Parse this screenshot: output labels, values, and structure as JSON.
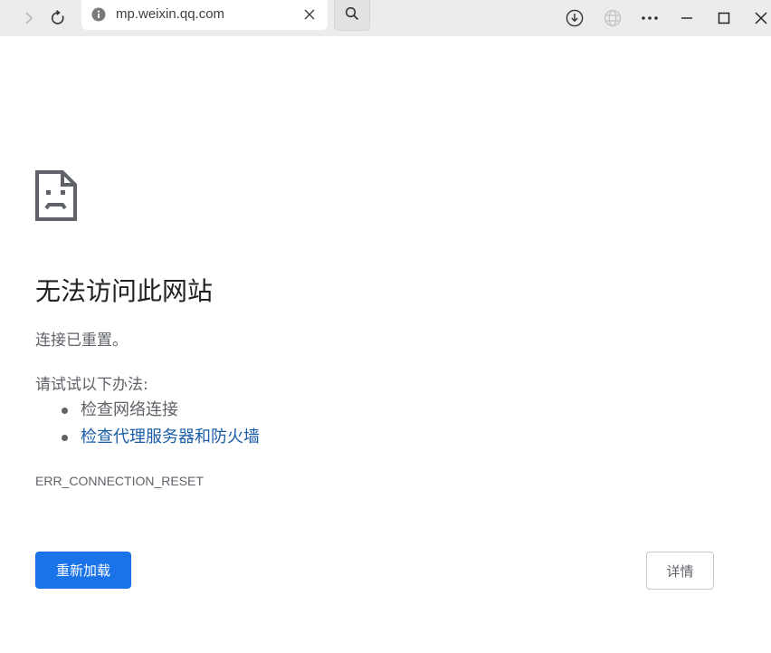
{
  "browser": {
    "url": "mp.weixin.qq.com",
    "icons": {
      "forward": "chevron-right-icon",
      "reload": "reload-icon",
      "site_info": "info-icon",
      "clear": "close-icon",
      "search": "search-icon",
      "download": "download-icon",
      "translate": "globe-icon",
      "more": "more-icon",
      "minimize": "minimize-icon",
      "maximize": "maximize-icon",
      "close": "close-icon"
    }
  },
  "error_page": {
    "icon": "sad-page-icon",
    "title": "无法访问此网站",
    "subtitle": "连接已重置。",
    "suggestions_label": "请试试以下办法:",
    "suggestions": [
      {
        "text": "检查网络连接",
        "is_link": false
      },
      {
        "text": "检查代理服务器和防火墙",
        "is_link": true
      }
    ],
    "error_code": "ERR_CONNECTION_RESET",
    "reload_label": "重新加载",
    "details_label": "详情"
  },
  "colors": {
    "primary_button": "#1a73e8",
    "link": "#1a5ea8",
    "secondary_text": "#5f6368"
  }
}
